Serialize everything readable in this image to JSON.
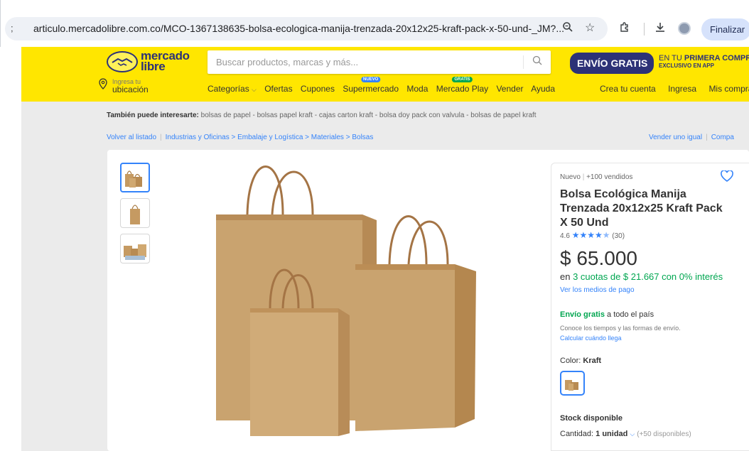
{
  "browser": {
    "address_lead": ";",
    "url": "articulo.mercadolibre.com.co/MCO-1367138635-bolsa-ecologica-manija-trenzada-20x12x25-kraft-pack-x-50-und-_JM?...",
    "finalizar_label": "Finalizar"
  },
  "header": {
    "logo_text_line1": "mercado",
    "logo_text_line2": "libre",
    "search_placeholder": "Buscar productos, marcas y más...",
    "envio_gratis": "ENVÍO GRATIS",
    "promo_line1_prefix": "EN TU ",
    "promo_line1_bold": "PRIMERA COMPRA",
    "promo_line2": "EXCLUSIVO EN APP",
    "location_line1": "Ingresa tu",
    "location_line2": "ubicación",
    "nav": {
      "categorias": "Categorías",
      "ofertas": "Ofertas",
      "cupones": "Cupones",
      "supermercado": "Supermercado",
      "supermercado_badge": "NUEVO",
      "moda": "Moda",
      "mercado_play": "Mercado Play",
      "mercado_play_badge": "GRATIS",
      "vender": "Vender",
      "ayuda": "Ayuda"
    },
    "user_nav": {
      "crea_cuenta": "Crea tu cuenta",
      "ingresa": "Ingresa",
      "mis_compras": "Mis compras"
    }
  },
  "suggestions": {
    "label": "También puede interesarte:",
    "items": "bolsas de papel - bolsas papel kraft - cajas carton kraft - bolsa doy pack con valvula - bolsas de papel kraft"
  },
  "breadcrumb": {
    "back": "Volver al listado",
    "c1": "Industrias y Oficinas",
    "c2": "Embalaje y Logística",
    "c3": "Materiales",
    "c4": "Bolsas",
    "sep": ">",
    "vender_igual": "Vender uno igual",
    "compartir": "Compa"
  },
  "product": {
    "condition": "Nuevo",
    "sold": "+100 vendidos",
    "title": "Bolsa Ecológica Manija Trenzada 20x12x25 Kraft Pack X 50 Und",
    "rating_value": "4.6",
    "rating_stars": 4.6,
    "rating_count": "(30)",
    "price": "$ 65.000",
    "cuotas_prefix": "en ",
    "cuotas_text": "3 cuotas de $ 21.667 con 0% interés",
    "medios_pago": "Ver los medios de pago",
    "envio_bold": "Envío gratis",
    "envio_rest": " a todo el país",
    "conoce": "Conoce los tiempos y las formas de envío.",
    "calcular": "Calcular cuándo llega",
    "color_label": "Color: ",
    "color_value": "Kraft",
    "stock": "Stock disponible",
    "cantidad_label": "Cantidad: ",
    "cantidad_value": "1 unidad",
    "disponibles": "(+50 disponibles)"
  },
  "colors": {
    "ml_yellow": "#ffe600",
    "ml_navy": "#2d3277",
    "link_blue": "#3483fa",
    "green": "#00a650",
    "kraft": "#c9a36f"
  },
  "icons": {
    "zoom": "zoom-icon",
    "star": "bookmark-star-icon",
    "extensions": "extensions-icon",
    "download": "download-icon",
    "search": "search-icon",
    "location": "location-pin-icon",
    "heart": "heart-icon"
  }
}
